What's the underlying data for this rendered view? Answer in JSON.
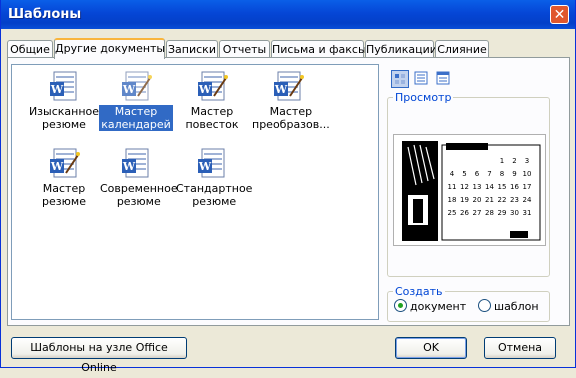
{
  "window": {
    "title": "Шаблоны"
  },
  "tabs": [
    {
      "label": "Общие"
    },
    {
      "label": "Другие документы"
    },
    {
      "label": "Записки"
    },
    {
      "label": "Отчеты"
    },
    {
      "label": "Письма и факсы"
    },
    {
      "label": "Публикации"
    },
    {
      "label": "Слияние"
    }
  ],
  "templates": [
    {
      "line1": "Изысканное",
      "line2": "резюме",
      "icon": "word-document-icon"
    },
    {
      "line1": "Мастер",
      "line2": "календарей",
      "icon": "word-wizard-icon"
    },
    {
      "line1": "Мастер",
      "line2": "повесток",
      "icon": "word-wizard-icon"
    },
    {
      "line1": "Мастер",
      "line2": "преобразов...",
      "icon": "word-wizard-icon"
    },
    {
      "line1": "Мастер",
      "line2": "резюме",
      "icon": "word-wizard-icon"
    },
    {
      "line1": "Современное",
      "line2": "резюме",
      "icon": "word-document-icon"
    },
    {
      "line1": "Стандартное",
      "line2": "резюме",
      "icon": "word-document-icon"
    }
  ],
  "selected_template": "Мастер календарей",
  "preview": {
    "label": "Просмотр",
    "month_rows": [
      [
        "",
        "",
        "",
        "1",
        "2",
        "3"
      ],
      [
        "4",
        "5",
        "6",
        "7",
        "8",
        "9",
        "10"
      ],
      [
        "11",
        "12",
        "13",
        "14",
        "15",
        "16",
        "17"
      ],
      [
        "18",
        "19",
        "20",
        "21",
        "22",
        "23",
        "24"
      ],
      [
        "25",
        "26",
        "27",
        "28",
        "29",
        "30",
        "31"
      ]
    ]
  },
  "create": {
    "label": "Создать",
    "options": [
      {
        "label": "документ",
        "selected": true
      },
      {
        "label": "шаблон",
        "selected": false
      }
    ]
  },
  "buttons": {
    "online": "Шаблоны на узле Office Online",
    "ok": "OK",
    "cancel": "Отмена"
  },
  "colors": {
    "titlebar": "#0546d6",
    "selection": "#316ac5",
    "active_tab_accent": "#f9b53c",
    "group_label": "#0046d5"
  }
}
